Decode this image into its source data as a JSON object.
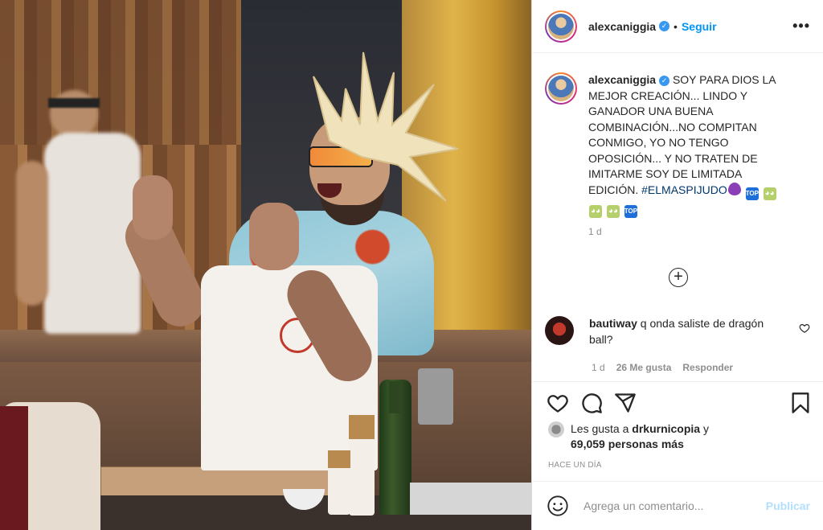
{
  "post": {
    "username": "alexcaniggia",
    "dot": "•",
    "follow_label": "Seguir",
    "more_label": "•••",
    "caption": {
      "body": "SOY PARA DIOS LA MEJOR CREACIÓN... LINDO Y GANADOR UNA BUENA COMBINACIÓN...NO COMPITAN CONMIGO, YO NO TENGO OPOSICIÓN... Y NO TRATEN DE IMITARME SOY DE LIMITADA EDICIÓN.",
      "hashtag": "#ELMASPIJUDO",
      "emojis": [
        "eggplant-emoji",
        "top-emoji",
        "pig-nose-emoji"
      ],
      "time": "1 d"
    },
    "comment": {
      "username": "bautiway",
      "text": "q onda saliste de dragón ball?",
      "time": "1 d",
      "likes": "26 Me gusta",
      "reply_label": "Responder"
    },
    "likes_line": {
      "prefix": "Les gusta a",
      "user": "drkurnicopia",
      "connector": "y",
      "count": "69,059 personas más"
    },
    "ago": "HACE UN DÍA",
    "add_comment": {
      "placeholder": "Agrega un comentario...",
      "publish_label": "Publicar"
    },
    "icons": {
      "like": "heart-icon",
      "comment": "comment-icon",
      "share": "share-icon",
      "save": "bookmark-icon",
      "emoji": "smile-icon",
      "add": "plus-circle-icon",
      "verified": "verified-badge-icon"
    }
  }
}
